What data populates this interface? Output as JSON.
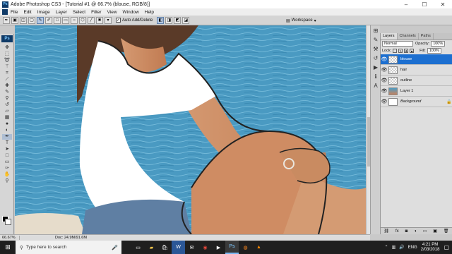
{
  "window": {
    "title": "Adobe Photoshop CS3 - [Tutorial #1 @ 66.7% (blouse, RGB/8)]",
    "controls": [
      "–",
      "☐",
      "✕"
    ]
  },
  "menu": [
    "File",
    "Edit",
    "Image",
    "Layer",
    "Select",
    "Filter",
    "View",
    "Window",
    "Help"
  ],
  "options_bar": {
    "auto_add_delete_label": "Auto Add/Delete",
    "auto_add_delete_checked": true,
    "workspace_label": "Workspace"
  },
  "status_bar": {
    "zoom": "66.67%",
    "doc": "Doc: 24.9M/91.6M"
  },
  "panel": {
    "tabs": [
      "Layers",
      "Channels",
      "Paths"
    ],
    "blend_mode": "Normal",
    "opacity_label": "Opacity:",
    "opacity": "100%",
    "lock_label": "Lock:",
    "fill_label": "Fill:",
    "fill": "100%",
    "layers": [
      {
        "name": "blouse",
        "selected": true,
        "thumb": "transparent"
      },
      {
        "name": "hair",
        "selected": false,
        "thumb": "transparent"
      },
      {
        "name": "outline",
        "selected": false,
        "thumb": "transparent"
      },
      {
        "name": "Layer 1",
        "selected": false,
        "thumb": "photo"
      },
      {
        "name": "Background",
        "selected": false,
        "thumb": "white",
        "italic": true,
        "locked": true
      }
    ]
  },
  "taskbar": {
    "search_placeholder": "Type here to search",
    "time": "4:21 PM",
    "date": "2/03/2018",
    "language": "ENG",
    "apps": [
      "task-view",
      "file-explorer",
      "store",
      "word",
      "mail",
      "chrome",
      "media",
      "photoshop",
      "firefox",
      "vlc"
    ]
  },
  "colors": {
    "selection_blue": "#1c6fd0",
    "sea": "#4d9cc3",
    "skin": "#d08f6a"
  }
}
